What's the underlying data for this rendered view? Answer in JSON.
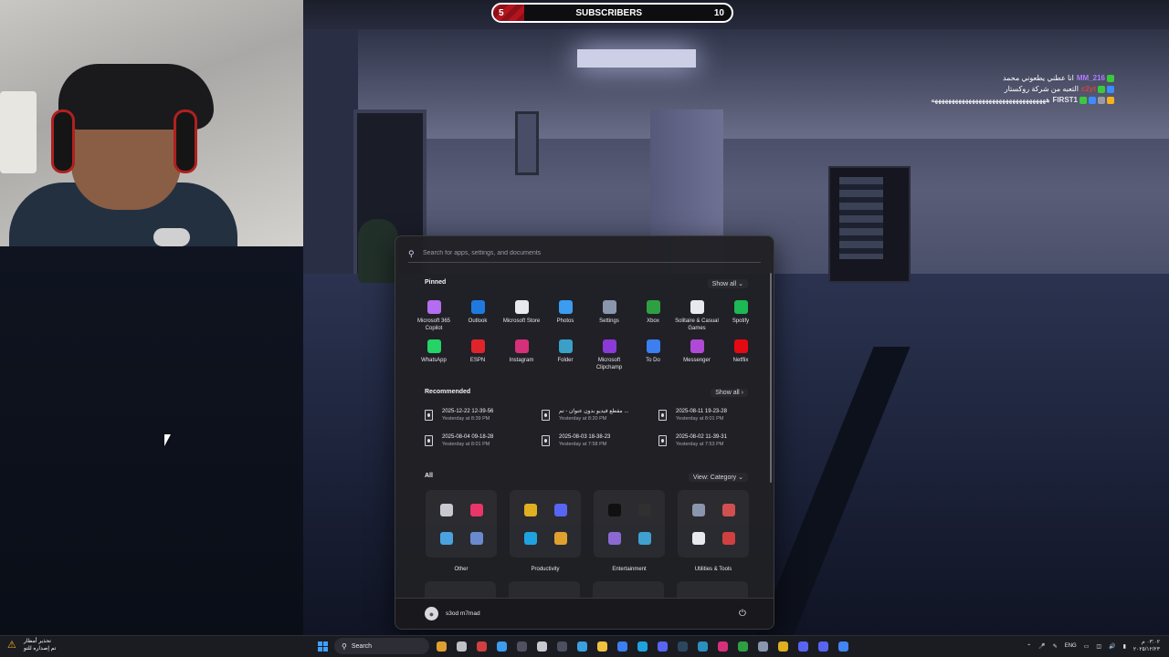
{
  "stream": {
    "subscriber_goal": {
      "from": "5",
      "label": "SUBSCRIBERS",
      "to": "10",
      "progress": 0.0,
      "bar_color": "#b3141e"
    },
    "chat": [
      {
        "user": "MM_216",
        "user_color": "#b07bff",
        "message": "انا عطني يطعوني محمد",
        "badges": [
          "#3cc83c"
        ]
      },
      {
        "user": "c2yt",
        "user_color": "#d5443a",
        "message": "التعبه من شركة روكستار",
        "badges": [
          "#3cc83c",
          "#3b8cff"
        ]
      },
      {
        "user": "FIRST1",
        "user_color": "#e6e6ec",
        "message": "ههههههههههههههههههههههههههههههههههه",
        "badges": [
          "#3cc83c",
          "#3b8cff",
          "#9a9aa6",
          "#f5b21b"
        ]
      }
    ]
  },
  "start_menu": {
    "search": {
      "placeholder": "Search for apps, settings, and documents"
    },
    "pinned": {
      "title": "Pinned",
      "show_all": "Show all",
      "apps": [
        {
          "label": "Microsoft 365 Copilot",
          "icon": "copilot-icon",
          "color": "#b46cf0"
        },
        {
          "label": "Outlook",
          "icon": "outlook-icon",
          "color": "#1f7ae0"
        },
        {
          "label": "Microsoft Store",
          "icon": "store-icon",
          "color": "#e8e8ee"
        },
        {
          "label": "Photos",
          "icon": "photos-icon",
          "color": "#3b9cf0"
        },
        {
          "label": "Settings",
          "icon": "gear-icon",
          "color": "#8a96ad"
        },
        {
          "label": "Xbox",
          "icon": "xbox-icon",
          "color": "#2ea043"
        },
        {
          "label": "Solitaire & Casual Games",
          "icon": "solitaire-icon",
          "color": "#e8e8ee"
        },
        {
          "label": "Spotify",
          "icon": "spotify-icon",
          "color": "#1db954"
        },
        {
          "label": "WhatsApp",
          "icon": "whatsapp-icon",
          "color": "#25d366"
        },
        {
          "label": "ESPN",
          "icon": "espn-icon",
          "color": "#e0242c"
        },
        {
          "label": "Instagram",
          "icon": "instagram-icon",
          "color": "#d6307a"
        },
        {
          "label": "Folder",
          "icon": "folder-icon",
          "color": "#3aa0c8"
        },
        {
          "label": "Microsoft Clipchamp",
          "icon": "clipchamp-icon",
          "color": "#8a3ad6"
        },
        {
          "label": "To Do",
          "icon": "todo-icon",
          "color": "#3b7ff0"
        },
        {
          "label": "Messenger",
          "icon": "messenger-icon",
          "color": "#b04ad6"
        },
        {
          "label": "Netflix",
          "icon": "netflix-icon",
          "color": "#e50914"
        }
      ]
    },
    "recommended": {
      "title": "Recommended",
      "show_all": "Show all",
      "items": [
        {
          "name": "2025-12-22 12-39-56",
          "time": "Yesterday at 8:39 PM"
        },
        {
          "name": "مقطع فيديو بدون عنوان - تم ...",
          "time": "Yesterday at 8:20 PM"
        },
        {
          "name": "2025-08-11 19-23-28",
          "time": "Yesterday at 8:01 PM"
        },
        {
          "name": "2025-08-04 09-18-28",
          "time": "Yesterday at 8:01 PM"
        },
        {
          "name": "2025-08-03 18-38-23",
          "time": "Yesterday at 7:58 PM"
        },
        {
          "name": "2025-08-02 11-39-31",
          "time": "Yesterday at 7:53 PM"
        }
      ]
    },
    "all": {
      "title": "All",
      "view": "View: Category",
      "categories": [
        {
          "label": "Other",
          "icons": [
            "#c8c8d0",
            "#e8356a",
            "#4aa3e0",
            "#6a8ad0"
          ]
        },
        {
          "label": "Productivity",
          "icons": [
            "#e0b020",
            "#5865f2",
            "#1fa3e0",
            "#e0a030"
          ]
        },
        {
          "label": "Entertainment",
          "icons": [
            "#101010",
            "#303030",
            "#8a6ad0",
            "#40a0d0"
          ]
        },
        {
          "label": "Utilities & Tools",
          "icons": [
            "#8a96ad",
            "#d05050",
            "#e8e8ee",
            "#d04040"
          ]
        }
      ]
    },
    "user": {
      "name": "s3od m7mad"
    }
  },
  "taskbar": {
    "weather": {
      "title": "تحذير أمطار",
      "subtitle": "تم إصداره للتو"
    },
    "search_label": "Search",
    "apps": [
      "#e0a030",
      "#c0c0c8",
      "#d04040",
      "#3b9cf0",
      "#505060",
      "#c8c8d0",
      "#4a5060",
      "#3aa0e0",
      "#f0c040",
      "#3b7ff0",
      "#1fa3e0",
      "#5865f2",
      "#2a475e",
      "#2a90c0",
      "#d6307a",
      "#2ea043",
      "#8a96ad",
      "#e0b020",
      "#5865f2",
      "#5865f2",
      "#4285f4"
    ],
    "language": "ENG",
    "time": "٠٣:٠٢ م",
    "date": "٢٠٢٥/١٢/٢٣"
  }
}
